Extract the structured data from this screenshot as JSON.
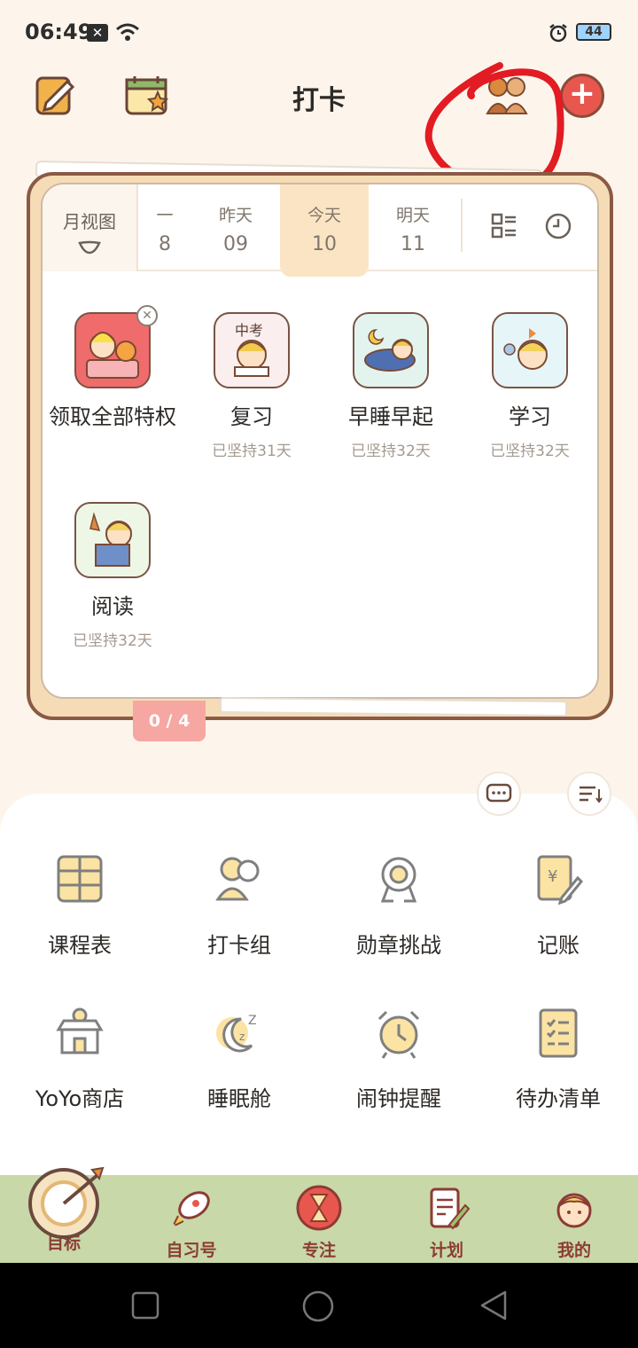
{
  "status": {
    "time": "06:49",
    "battery": "44"
  },
  "header": {
    "title": "打卡"
  },
  "date_bar": {
    "month_view": "月视图",
    "days": [
      {
        "weekday": "一",
        "date": "8"
      },
      {
        "weekday": "昨天",
        "date": "09"
      },
      {
        "weekday": "今天",
        "date": "10"
      },
      {
        "weekday": "明天",
        "date": "11"
      }
    ]
  },
  "habits": [
    {
      "name": "领取全部特权",
      "sub": ""
    },
    {
      "name": "复习",
      "sub": "已坚持31天"
    },
    {
      "name": "早睡早起",
      "sub": "已坚持32天"
    },
    {
      "name": "学习",
      "sub": "已坚持32天"
    },
    {
      "name": "阅读",
      "sub": "已坚持32天"
    }
  ],
  "habit_badge": "中考",
  "progress": "0 / 4",
  "tools": [
    {
      "label": "课程表",
      "icon": "schedule-icon"
    },
    {
      "label": "打卡组",
      "icon": "group-icon"
    },
    {
      "label": "勋章挑战",
      "icon": "medal-icon"
    },
    {
      "label": "记账",
      "icon": "ledger-icon"
    },
    {
      "label": "YoYo商店",
      "icon": "shop-icon"
    },
    {
      "label": "睡眠舱",
      "icon": "sleep-icon"
    },
    {
      "label": "闹钟提醒",
      "icon": "alarm-icon"
    },
    {
      "label": "待办清单",
      "icon": "todo-icon"
    }
  ],
  "tabs": [
    {
      "label": "目标",
      "icon": "target-icon"
    },
    {
      "label": "自习号",
      "icon": "rocket-icon"
    },
    {
      "label": "专注",
      "icon": "hourglass-icon"
    },
    {
      "label": "计划",
      "icon": "clipboard-icon"
    },
    {
      "label": "我的",
      "icon": "profile-icon"
    }
  ],
  "colors": {
    "accent": "#e8574e",
    "tabbar": "#c9d8a8",
    "tab_text": "#8b3c35",
    "annotation": "#e31b23"
  }
}
